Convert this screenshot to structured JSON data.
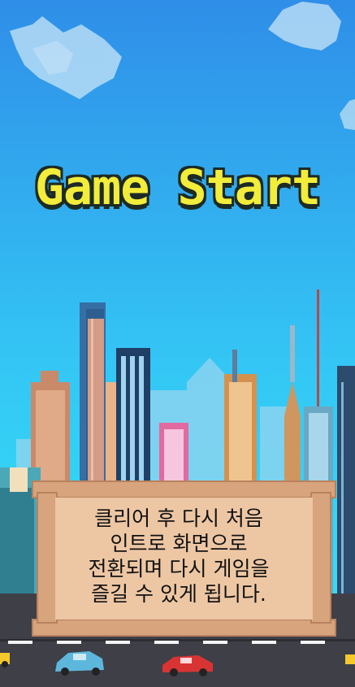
{
  "game": {
    "title": "Game Start",
    "message": "클리어 후 다시 처음\n인트로 화면으로\n전환되며 다시 게임을\n즐길 수 있게 됩니다."
  },
  "colors": {
    "sky_top": "#2f8ee8",
    "sky_bottom": "#33e6f6",
    "title_fill": "#f2ec3b",
    "panel_fill": "#edc7a4",
    "panel_frame": "#d7a47e",
    "road": "#3e3f47"
  },
  "icons": [
    "cloud-icon",
    "skyscraper-icon",
    "car-icon"
  ]
}
